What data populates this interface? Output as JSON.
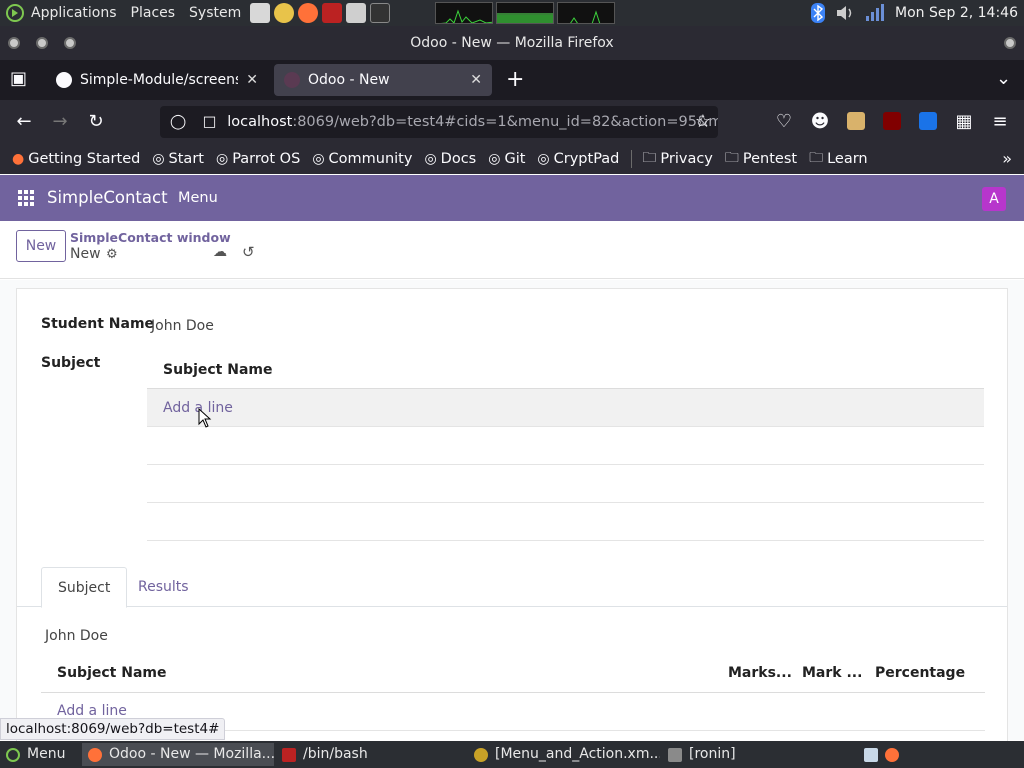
{
  "system_panel": {
    "menus": [
      "Applications",
      "Places",
      "System"
    ],
    "clock": "Mon Sep  2, 14:46"
  },
  "window": {
    "title": "Odoo - New — Mozilla Firefox"
  },
  "browser": {
    "tabs": [
      {
        "label": "Simple-Module/screensh",
        "active": false
      },
      {
        "label": "Odoo - New",
        "active": true
      }
    ],
    "url": {
      "host": "localhost",
      "rest": ":8069/web?db=test4#cids=1&menu_id=82&action=95&m"
    },
    "bookmarks": [
      "Getting Started",
      "Start",
      "Parrot OS",
      "Community",
      "Docs",
      "Git",
      "CryptPad"
    ],
    "bookmark_folders": [
      "Privacy",
      "Pentest",
      "Learn"
    ],
    "status_link": "localhost:8069/web?db=test4#"
  },
  "odoo": {
    "brand": "SimpleContact",
    "menu": "Menu",
    "avatar": "A",
    "accent": "#71639e",
    "control": {
      "new_button": "New",
      "breadcrumb_parent": "SimpleContact window",
      "breadcrumb_current": "New"
    },
    "form": {
      "student_name_label": "Student Name",
      "student_name_value": "John Doe",
      "subject_label": "Subject",
      "subject_table": {
        "header": "Subject Name",
        "add_line": "Add a line"
      },
      "notebook": {
        "tabs": [
          "Subject",
          "Results"
        ],
        "active_tab": "Subject",
        "name_value": "John Doe",
        "columns": [
          "Subject Name",
          "Marks...",
          "Mark ...",
          "Percentage"
        ],
        "add_line": "Add a line"
      }
    }
  },
  "taskbar": {
    "items": [
      "Menu",
      "Odoo - New — Mozilla...",
      "/bin/bash",
      "[Menu_and_Action.xm...",
      "[ronin]"
    ]
  }
}
